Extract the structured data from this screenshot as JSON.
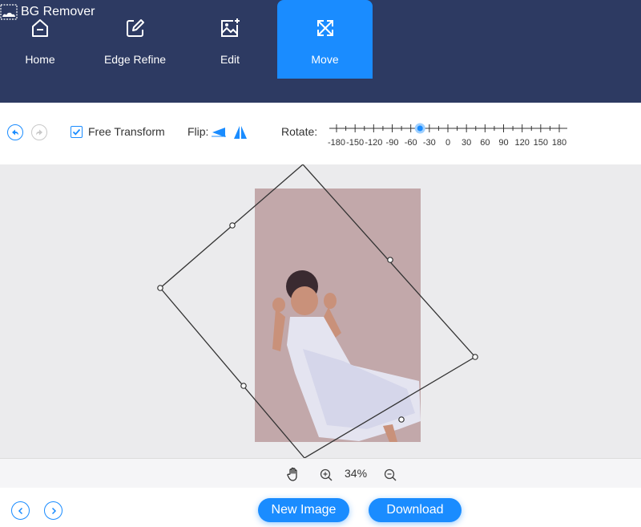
{
  "app": {
    "title": "BG Remover"
  },
  "tabs": [
    {
      "label": "Home",
      "icon": "home-icon"
    },
    {
      "label": "Edge Refine",
      "icon": "edit-square-icon"
    },
    {
      "label": "Edit",
      "icon": "image-edit-icon"
    },
    {
      "label": "Move",
      "icon": "move-arrows-icon",
      "active": true
    }
  ],
  "toolbar": {
    "free_transform_label": "Free Transform",
    "free_transform_checked": true,
    "flip_label": "Flip:",
    "rotate_label": "Rotate:",
    "rotate_ticks": [
      "-180",
      "-150",
      "-120",
      "-90",
      "-60",
      "-30",
      "0",
      "30",
      "60",
      "90",
      "120",
      "150",
      "180"
    ],
    "rotate_value": -45
  },
  "zoom": {
    "value": "34%"
  },
  "footer": {
    "new_image_label": "New Image",
    "download_label": "Download"
  },
  "colors": {
    "header_bg": "#2d3a62",
    "accent": "#1a8cff",
    "canvas_bg": "#ebebed"
  }
}
